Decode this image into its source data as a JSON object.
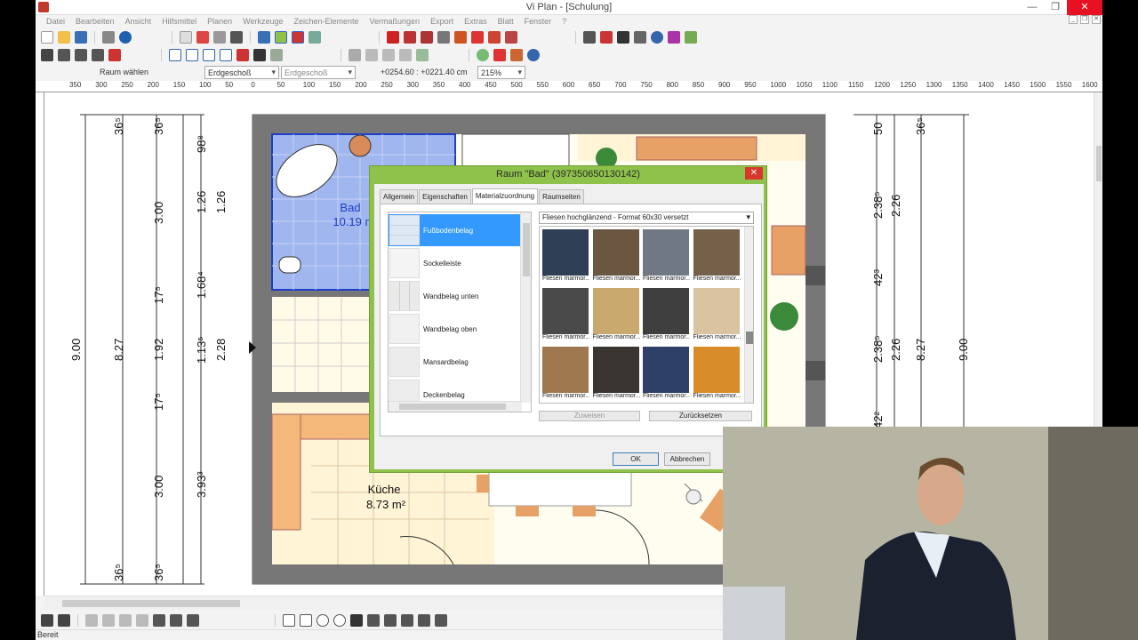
{
  "window": {
    "title": "Vi Plan - [Schulung]"
  },
  "menu": [
    "Datei",
    "Bearbeiten",
    "Ansicht",
    "Hilfsmittel",
    "Planen",
    "Werkzeuge",
    "Zeichen-Elemente",
    "Vermaßungen",
    "Export",
    "Extras",
    "Blatt",
    "Fenster",
    "?"
  ],
  "propbar": {
    "tool_label": "Raum wählen",
    "floor1": "Erdgeschoß",
    "floor2": "Erdgeschoß",
    "coords": "+0254.60 : +0221.40 cm",
    "zoom": "215%"
  },
  "ruler": [
    "350",
    "300",
    "250",
    "200",
    "150",
    "100",
    "50",
    "0",
    "50",
    "100",
    "150",
    "200",
    "250",
    "300",
    "350",
    "400",
    "450",
    "500",
    "550",
    "600",
    "650",
    "700",
    "750",
    "800",
    "850",
    "900",
    "950",
    "1000",
    "1050",
    "1100",
    "1150",
    "1200",
    "1250",
    "1300",
    "1350",
    "1400",
    "1450",
    "1500",
    "1550",
    "1600"
  ],
  "plan": {
    "rooms": [
      {
        "name": "Bad",
        "area": "10.19 m²"
      },
      {
        "name": "Küche",
        "area": "8.73 m²"
      }
    ],
    "dims_left": [
      "36⁵",
      "36⁵",
      "98⁸",
      "3.00",
      "1.26",
      "1.26",
      "17⁵",
      "1.68⁴",
      "9.00",
      "8.27",
      "1.92",
      "1.13⁵",
      "2.28",
      "17⁵",
      "3.00",
      "3.93³",
      "36⁵",
      "36⁵"
    ],
    "dims_right": [
      "50",
      "36⁵",
      "2.38⁵",
      "2.26",
      "42³",
      "2.38⁵",
      "2.26",
      "8.27",
      "9.00",
      "42²"
    ]
  },
  "dialog": {
    "title": "Raum \"Bad\" (397350650130142)",
    "close": "✕",
    "tabs": [
      "Allgemein",
      "Eigenschaften",
      "Materialzuordnung",
      "Raumseiten"
    ],
    "active_tab": "Materialzuordnung",
    "categories": [
      "Fußbodenbelag",
      "Sockelleiste",
      "Wandbelag unten",
      "Wandbelag oben",
      "Mansardbelag",
      "Deckenbelag"
    ],
    "selected_category": "Fußbodenbelag",
    "material_select": "Fliesen hochglänzend - Format 60x30 versetzt",
    "materials": [
      {
        "caption": "Fliesen marmor...",
        "color": "#2f3f55"
      },
      {
        "caption": "Fliesen marmor...",
        "color": "#6b5641"
      },
      {
        "caption": "Fliesen marmor...",
        "color": "#707884"
      },
      {
        "caption": "Fliesen marmor...",
        "color": "#75604a"
      },
      {
        "caption": "Fliesen marmor...",
        "color": "#4a4a4a"
      },
      {
        "caption": "Fliesen marmor...",
        "color": "#c9a96e"
      },
      {
        "caption": "Fliesen marmor...",
        "color": "#3f3f3f"
      },
      {
        "caption": "Fliesen marmor...",
        "color": "#d9c3a0"
      },
      {
        "caption": "Fliesen marmor...",
        "color": "#a0784f"
      },
      {
        "caption": "Fliesen marmor...",
        "color": "#3a3530"
      },
      {
        "caption": "Fliesen marmor...",
        "color": "#2e4068"
      },
      {
        "caption": "Fliesen marmor...",
        "color": "#d98c2a"
      }
    ],
    "assign_button": "Zuweisen",
    "reset_button": "Zurücksetzen",
    "ok_button": "OK",
    "cancel_button": "Abbrechen"
  },
  "status": "Bereit",
  "colors": {
    "dialog_frame": "#8fc24a",
    "selection_blue": "#3399ff",
    "room_blue": "#9fb6ee"
  }
}
